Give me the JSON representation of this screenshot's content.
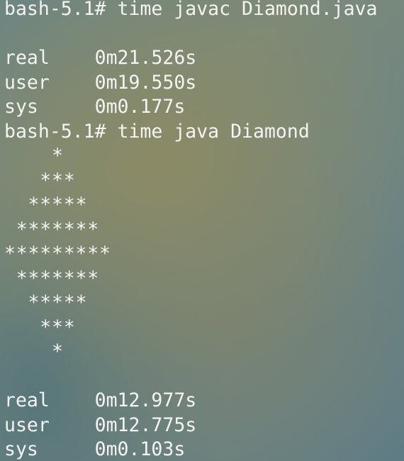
{
  "terminal": {
    "lines": [
      "bash-5.1# time javac Diamond.java",
      "",
      "real    0m21.526s",
      "user    0m19.550s",
      "sys     0m0.177s",
      "bash-5.1# time java Diamond",
      "    *",
      "   ***",
      "  *****",
      " *******",
      "*********",
      " *******",
      "  *****",
      "   ***",
      "    *",
      "",
      "real    0m12.977s",
      "user    0m12.775s",
      "sys     0m0.103s"
    ]
  }
}
